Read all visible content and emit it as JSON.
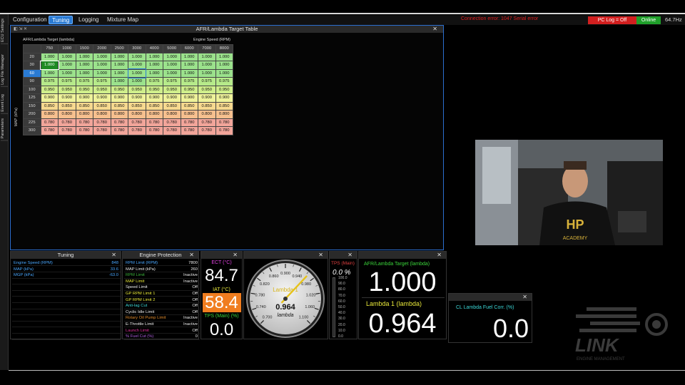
{
  "menu": {
    "items": [
      {
        "label": "Configuration",
        "active": false
      },
      {
        "label": "Tuning",
        "active": true
      },
      {
        "label": "Logging",
        "active": false
      },
      {
        "label": "Mixture Map",
        "active": false
      }
    ]
  },
  "status": {
    "connection_error": "Connection error: 1047 Serial error",
    "pc_log": "PC Log = Off",
    "online": "Online",
    "rate": "64.7Hz"
  },
  "sidebar": {
    "tabs": [
      "ECU Settings",
      "Log File Manager",
      "Event Log",
      "Parameters"
    ]
  },
  "table_window": {
    "title": "AFR/Lambda Target Table",
    "left_label": "AFR/Lambda Target (lambda)",
    "top_label": "Engine Speed (RPM)",
    "axis_label": "MAP (kPa)",
    "rpm": [
      "750",
      "1000",
      "1500",
      "2000",
      "2500",
      "3000",
      "4000",
      "5000",
      "6000",
      "7000",
      "8000"
    ],
    "rows": [
      {
        "map": "20",
        "values": [
          "1.000",
          "1.000",
          "1.000",
          "1.000",
          "1.000",
          "1.000",
          "1.000",
          "1.000",
          "1.000",
          "1.000",
          "1.000"
        ]
      },
      {
        "map": "30",
        "values": [
          "1.000",
          "1.000",
          "1.000",
          "1.000",
          "1.000",
          "1.000",
          "1.000",
          "1.000",
          "1.000",
          "1.000",
          "1.000"
        ]
      },
      {
        "map": "60",
        "values": [
          "1.000",
          "1.000",
          "1.000",
          "1.000",
          "1.000",
          "1.000",
          "1.000",
          "1.000",
          "1.000",
          "1.000",
          "1.000"
        ]
      },
      {
        "map": "90",
        "values": [
          "0.975",
          "0.975",
          "0.975",
          "0.975",
          "1.000",
          "1.000",
          "0.975",
          "0.975",
          "0.975",
          "0.975",
          "0.975"
        ]
      },
      {
        "map": "100",
        "values": [
          "0.950",
          "0.950",
          "0.950",
          "0.950",
          "0.950",
          "0.950",
          "0.950",
          "0.950",
          "0.950",
          "0.950",
          "0.950"
        ]
      },
      {
        "map": "125",
        "values": [
          "0.900",
          "0.900",
          "0.900",
          "0.900",
          "0.900",
          "0.900",
          "0.900",
          "0.900",
          "0.900",
          "0.900",
          "0.900"
        ]
      },
      {
        "map": "150",
        "values": [
          "0.850",
          "0.850",
          "0.850",
          "0.850",
          "0.850",
          "0.850",
          "0.850",
          "0.850",
          "0.850",
          "0.850",
          "0.850"
        ]
      },
      {
        "map": "200",
        "values": [
          "0.800",
          "0.800",
          "0.800",
          "0.800",
          "0.800",
          "0.800",
          "0.800",
          "0.800",
          "0.800",
          "0.800",
          "0.800"
        ]
      },
      {
        "map": "225",
        "values": [
          "0.780",
          "0.780",
          "0.780",
          "0.780",
          "0.780",
          "0.780",
          "0.780",
          "0.780",
          "0.780",
          "0.780",
          "0.780"
        ]
      },
      {
        "map": "300",
        "values": [
          "0.780",
          "0.780",
          "0.780",
          "0.780",
          "0.780",
          "0.780",
          "0.780",
          "0.780",
          "0.780",
          "0.780",
          "0.780"
        ]
      }
    ],
    "selected_row_header": "60",
    "selected_col_header": "3000",
    "cell_colors": {
      "1.000": "#9be28c",
      "0.975": "#b6ea8a",
      "0.950": "#cfee8b",
      "0.900": "#eef29a",
      "0.850": "#f7d98f",
      "0.800": "#f6bf8e",
      "0.780": "#f2a59a"
    }
  },
  "tuning_panel": {
    "title": "Tuning",
    "rows": [
      {
        "label": "Engine Speed (RPM)",
        "value": "848",
        "color": "#4aa8ff"
      },
      {
        "label": "MAP (kPa)",
        "value": "33.6",
        "color": "#4aa8ff"
      },
      {
        "label": "MGP (kPa)",
        "value": "-63.0",
        "color": "#4aa8ff"
      }
    ],
    "empty_rows": 10
  },
  "protection_panel": {
    "title": "Engine Protection",
    "rows": [
      {
        "label": "RPM Limit (RPM)",
        "value": "7800",
        "color": "#4aa8ff"
      },
      {
        "label": "MAP Limit (kPa)",
        "value": "260",
        "color": "#eee"
      },
      {
        "label": "RPM Limit",
        "value": "Inactive",
        "color": "#3db53d"
      },
      {
        "label": "MAP Limit",
        "value": "Inactive",
        "color": "#e8e83a"
      },
      {
        "label": "Speed Limit",
        "value": "Off",
        "color": "#eee"
      },
      {
        "label": "GP RPM Limit 1",
        "value": "Off",
        "color": "#e8e83a"
      },
      {
        "label": "GP RPM Limit 2",
        "value": "Off",
        "color": "#e8e83a"
      },
      {
        "label": "Anti-lag Cut",
        "value": "Off",
        "color": "#3bd6d6"
      },
      {
        "label": "Cyclic Idle Limit",
        "value": "Off",
        "color": "#eee"
      },
      {
        "label": "Rotary Oil Pump Limit",
        "value": "Inactive",
        "color": "#e08a2a"
      },
      {
        "label": "E-Throttle Limit",
        "value": "Inactive",
        "color": "#eee"
      },
      {
        "label": "Launch Limit",
        "value": "Off",
        "color": "#e0309b"
      },
      {
        "label": "% Fuel Cut (%)",
        "value": "0",
        "color": "#b060e0"
      }
    ]
  },
  "ect_panel": {
    "ect_label": "ECT (°C)",
    "ect_value": "84.7",
    "iat_label": "IAT (°C)",
    "iat_value": "58.4",
    "tps_label": "TPS (Main) (%)",
    "tps_value": "0.0"
  },
  "lambda_gauge": {
    "ticks": [
      "0.700",
      "0.740",
      "0.780",
      "0.820",
      "0.860",
      "0.900",
      "0.940",
      "0.980",
      "1.020",
      "1.060",
      "1.100"
    ],
    "title": "Lambda 1",
    "value": "0.964",
    "unit": "lambda",
    "min": 0.7,
    "max": 1.1
  },
  "tps_bar": {
    "label": "TPS (Main)",
    "value": "0.0 %",
    "fraction": 0.0,
    "ticks": [
      "100.0",
      "90.0",
      "80.0",
      "70.0",
      "60.0",
      "50.0",
      "40.0",
      "30.0",
      "20.0",
      "10.0",
      "0.0"
    ]
  },
  "afr_panel": {
    "target_label": "AFR/Lambda Target (lambda)",
    "target_value": "1.000",
    "lambda_label": "Lambda 1 (lambda)",
    "lambda_value": "0.964"
  },
  "cl_panel": {
    "label": "CL Lambda  Fuel  Corr. (%)",
    "value": "0.0"
  },
  "logo": {
    "word": "LINK",
    "tagline": "ENGINE MANAGEMENT"
  },
  "webcam": {
    "shirt_text": "HP",
    "shirt_sub": "ACADEMY"
  }
}
